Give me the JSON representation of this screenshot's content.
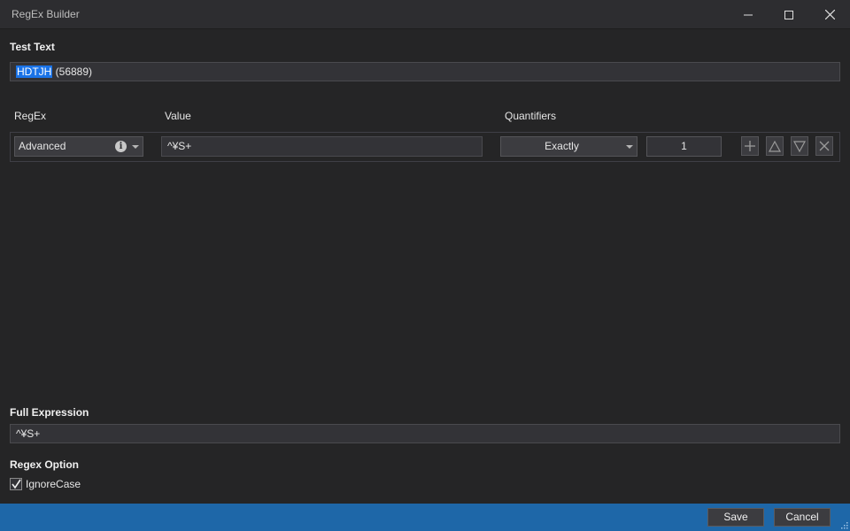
{
  "window": {
    "title": "RegEx Builder"
  },
  "test_text": {
    "label": "Test Text",
    "highlighted": "HDTJH",
    "rest": " (56889)"
  },
  "table": {
    "headers": {
      "regex": "RegEx",
      "value": "Value",
      "quantifiers": "Quantifiers"
    },
    "rows": [
      {
        "regex_type": "Advanced",
        "value": "^¥S+",
        "quantifier": "Exactly",
        "count": "1"
      }
    ]
  },
  "full_expression": {
    "label": "Full Expression",
    "value": "^¥S+"
  },
  "regex_option": {
    "label": "Regex Option",
    "ignore_case_label": "IgnoreCase",
    "ignore_case_checked": true
  },
  "footer": {
    "save_label": "Save",
    "cancel_label": "Cancel"
  },
  "colors": {
    "background": "#252526",
    "titlebar": "#2d2d30",
    "statusbar": "#1e67a8",
    "selection": "#1a73e8"
  },
  "icons": {
    "minimize": "minimize-icon",
    "maximize": "maximize-icon",
    "close": "close-icon",
    "info": "info-icon",
    "add": "plus-icon",
    "move_up": "triangle-up-icon",
    "move_down": "triangle-down-icon",
    "remove": "x-icon",
    "checkbox": "checkmark-icon",
    "resize": "resize-grip-icon"
  }
}
